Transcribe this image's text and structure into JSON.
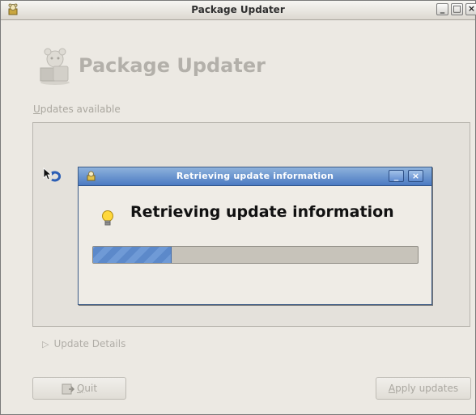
{
  "window": {
    "title": "Package Updater",
    "minimize_label": "_",
    "maximize_label": "□",
    "close_label": "×"
  },
  "header": {
    "title": "Package Updater",
    "icon": "package-updater-icon"
  },
  "updates": {
    "label_mnemonic": "U",
    "label_rest": "pdates available"
  },
  "details": {
    "expander_icon": "▷",
    "label": "Update Details"
  },
  "buttons": {
    "quit_mnemonic": "Q",
    "quit_rest": "uit",
    "apply_mnemonic": "A",
    "apply_rest": "pply updates"
  },
  "dialog": {
    "title": "Retrieving update information",
    "heading": "Retrieving update information",
    "minimize_label": "_",
    "close_label": "×",
    "progress_fraction": 0.24
  },
  "colors": {
    "dialog_titlebar": "#4b7ac2",
    "progress_fill": "#6f9ad6",
    "disabled_text": "#aaa79f"
  }
}
